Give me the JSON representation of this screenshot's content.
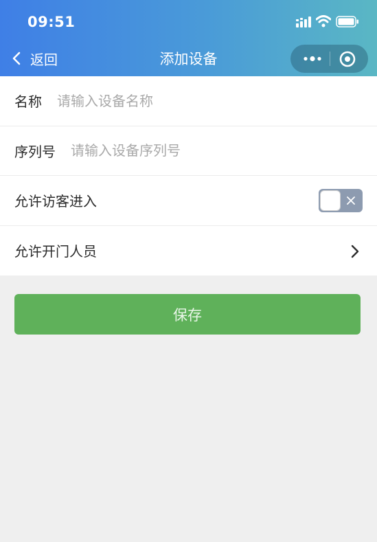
{
  "status_bar": {
    "time": "09:51"
  },
  "nav": {
    "back_label": "返回",
    "title": "添加设备"
  },
  "form": {
    "name": {
      "label": "名称",
      "placeholder": "请输入设备名称"
    },
    "serial": {
      "label": "序列号",
      "placeholder": "请输入设备序列号"
    },
    "allow_visitor": {
      "label": "允许访客进入",
      "enabled": false
    },
    "allowed_people": {
      "label": "允许开门人员"
    }
  },
  "save_button": {
    "label": "保存"
  },
  "colors": {
    "header_start": "#3f7fe6",
    "header_end": "#5ab7c4",
    "save_green": "#5fb15a",
    "background": "#efefef"
  }
}
